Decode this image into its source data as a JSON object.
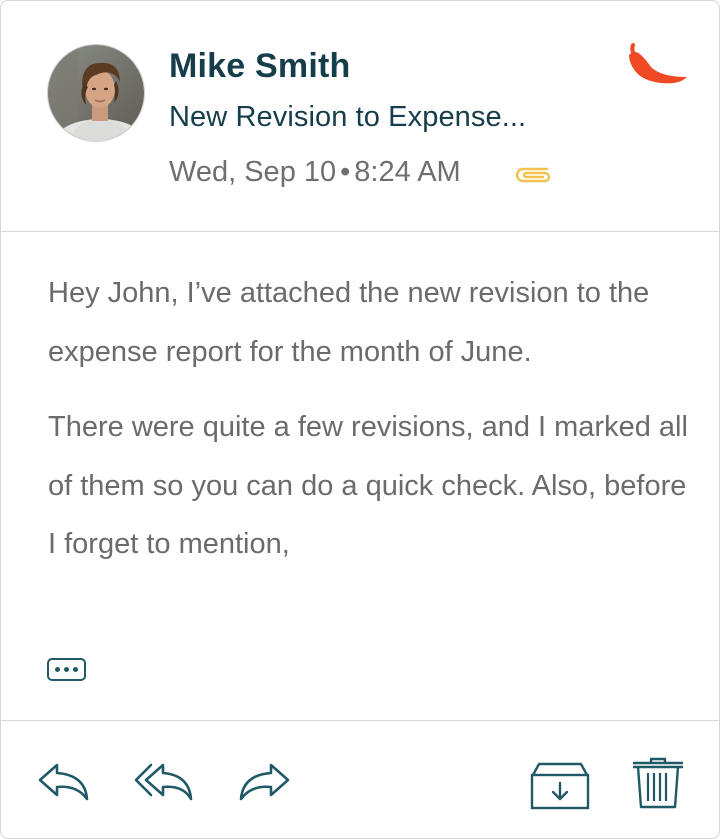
{
  "email": {
    "sender": "Mike Smith",
    "subject": "New Revision to Expense...",
    "date": "Wed, Sep 10",
    "separator": "•",
    "time": "8:24 AM",
    "has_attachment": true,
    "flag_icon": "chili-pepper-icon",
    "body_paragraphs": [
      "Hey John, I’ve attached the new revision to the expense report for the month of June.",
      "There were quite a few revisions, and I marked all of them so you can do a quick check. Also, before I forget to mention,"
    ]
  },
  "icons": {
    "attachment": "paperclip-icon",
    "more": "ellipsis-icon",
    "reply": "reply-icon",
    "reply_all": "reply-all-icon",
    "forward": "forward-icon",
    "archive": "archive-icon",
    "delete": "trash-icon"
  },
  "colors": {
    "primary": "#1f5a66",
    "sender_text": "#163d4a",
    "body_text": "#6b6b6b",
    "chili": "#f04a24",
    "attachment": "#f2c14e",
    "border": "#d6d6d6"
  }
}
